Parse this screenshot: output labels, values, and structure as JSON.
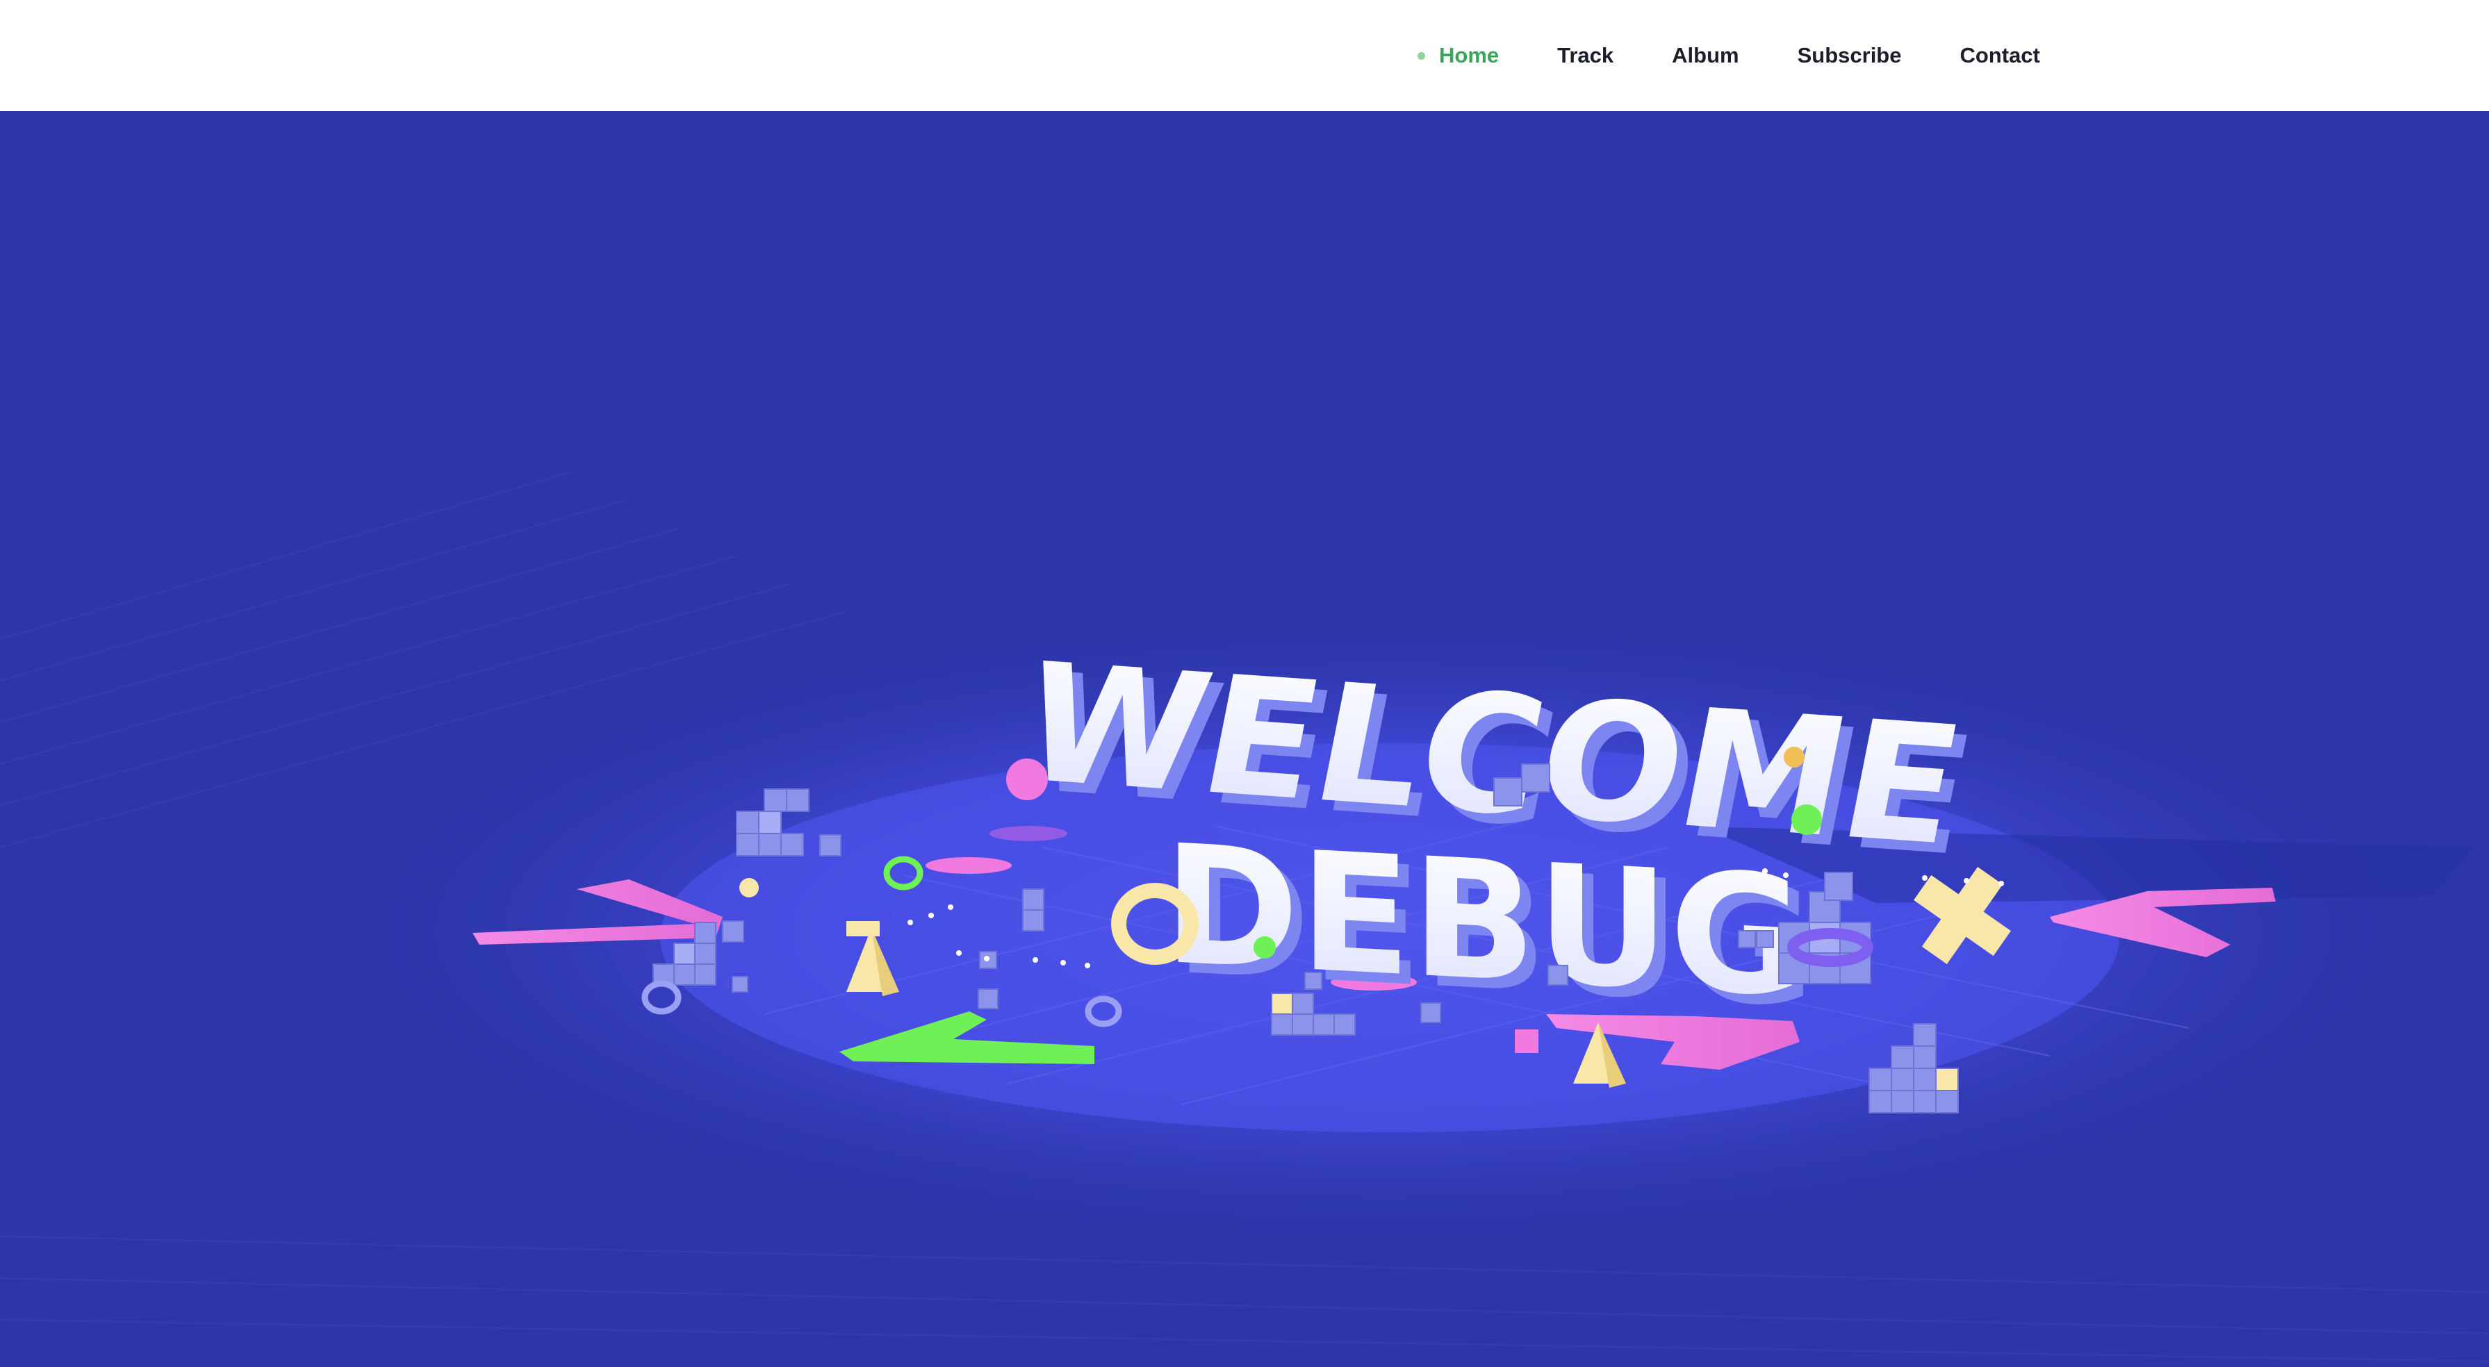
{
  "nav": {
    "items": [
      {
        "label": "Home",
        "active": true
      },
      {
        "label": "Track",
        "active": false
      },
      {
        "label": "Album",
        "active": false
      },
      {
        "label": "Subscribe",
        "active": false
      },
      {
        "label": "Contact",
        "active": false
      }
    ]
  },
  "hero": {
    "line1": "WELCOME",
    "line2": "DEBUG"
  },
  "colors": {
    "background": "#2c36a8",
    "floor_glow": "#4a52e6",
    "text_face": "#f2f4ff",
    "text_side": "#7d86f0",
    "pink": "#f07ae0",
    "green": "#6ef056",
    "yellow": "#f8e7a8",
    "cube": "#8b93ea",
    "active_nav": "#3aa55a"
  }
}
